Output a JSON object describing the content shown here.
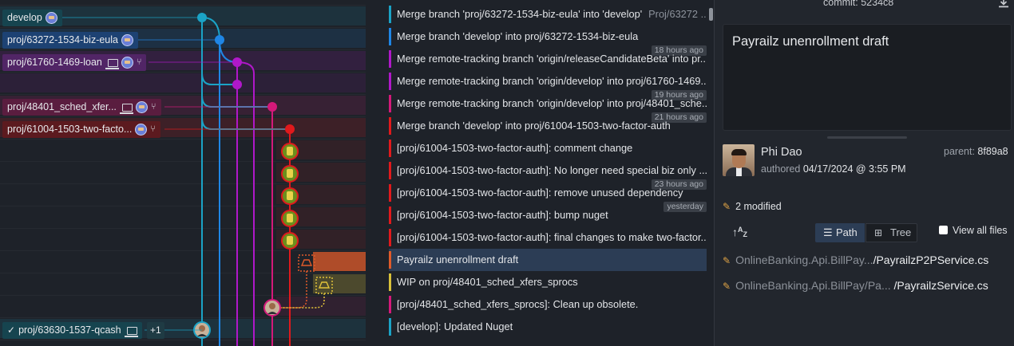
{
  "colors": {
    "cyan": "#1ba3c6",
    "blue": "#1f86e5",
    "purple": "#b018c9",
    "magenta": "#d4197a",
    "red": "#e0191c",
    "selected_row": "#2c3d55",
    "pencil": "#e0a446"
  },
  "graph": {
    "branch_labels": [
      {
        "name": "develop",
        "icons": [
          "origin"
        ]
      },
      {
        "name": "proj/63272-1534-biz-eula",
        "icons": [
          "origin"
        ]
      },
      {
        "name": "proj/61760-1469-loan",
        "icons": [
          "laptop",
          "origin",
          "fork"
        ]
      },
      {
        "name": "proj/48401_sched_xfer...",
        "icons": [
          "laptop",
          "origin",
          "fork"
        ]
      },
      {
        "name": "proj/61004-1503-two-facto...",
        "icons": [
          "origin",
          "fork"
        ]
      },
      {
        "name": "proj/63630-1537-qcash",
        "icons": [
          "check",
          "laptop"
        ],
        "extra": "+1"
      }
    ]
  },
  "commits": [
    {
      "message": "Merge branch 'proj/63272-1534-biz-eula' into 'develop'",
      "extra": "Proj/63272 ...",
      "color": "#1ba3c6"
    },
    {
      "message": "Merge branch 'develop' into proj/63272-1534-biz-eula",
      "time": "18 hours ago",
      "color": "#1f86e5"
    },
    {
      "message": "Merge remote-tracking branch 'origin/releaseCandidateBeta' into pr...",
      "color": "#b018c9"
    },
    {
      "message": "Merge remote-tracking branch 'origin/develop' into proj/61760-1469...",
      "time": "19 hours ago",
      "color": "#b018c9"
    },
    {
      "message": "Merge remote-tracking branch 'origin/develop' into proj/48401_sche...",
      "time": "21 hours ago",
      "color": "#d4197a"
    },
    {
      "message": "Merge branch 'develop' into proj/61004-1503-two-factor-auth",
      "color": "#e0191c"
    },
    {
      "message": "[proj/61004-1503-two-factor-auth]: comment change",
      "color": "#e0191c"
    },
    {
      "message": "[proj/61004-1503-two-factor-auth]: No longer need special biz only ...",
      "time": "23 hours ago",
      "color": "#e0191c"
    },
    {
      "message": "[proj/61004-1503-two-factor-auth]: remove unused dependency",
      "time": "yesterday",
      "color": "#e0191c"
    },
    {
      "message": "[proj/61004-1503-two-factor-auth]: bump nuget",
      "color": "#e0191c"
    },
    {
      "message": "[proj/61004-1503-two-factor-auth]: final changes to make two-factor...",
      "color": "#e0191c"
    },
    {
      "message": "Payrailz unenrollment draft",
      "color": "#e05b2a",
      "selected": true
    },
    {
      "message": "WIP on proj/48401_sched_xfers_sprocs",
      "color": "#d9c13a"
    },
    {
      "message": "[proj/48401_sched_xfers_sprocs]: Clean up obsolete.",
      "color": "#d4197a"
    },
    {
      "message": "[develop]: Updated Nuget",
      "color": "#1ba3c6"
    }
  ],
  "detail": {
    "commit_label": "commit:",
    "commit_sha": "5234c8",
    "summary": "Payrailz unenrollment draft",
    "author_name": "Phi Dao",
    "authored_label": "authored",
    "authored_date": "04/17/2024 @ 3:55 PM",
    "parent_label": "parent:",
    "parent_sha": "8f89a8",
    "modified_count": "2 modified",
    "view_path": "Path",
    "view_tree": "Tree",
    "view_all_files": "View all files",
    "files": [
      {
        "dir": "OnlineBanking.Api.BillPay...",
        "name": "/PayrailzP2PService.cs"
      },
      {
        "dir": "OnlineBanking.Api.BillPay/Pa...",
        "name": "/PayrailzService.cs"
      }
    ]
  }
}
